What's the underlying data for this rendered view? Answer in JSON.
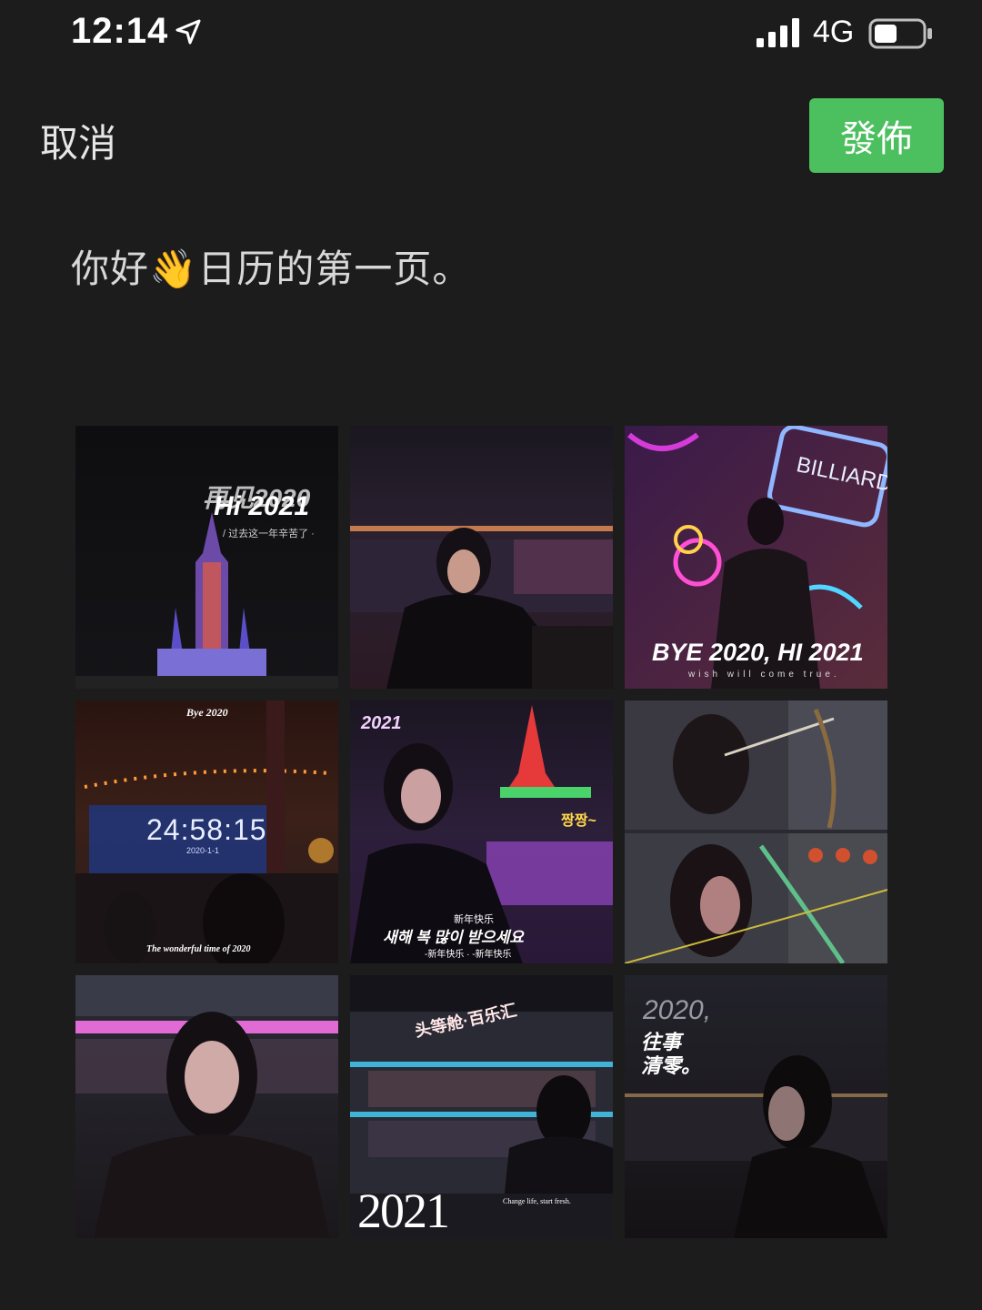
{
  "status_bar": {
    "time": "12:14",
    "network": "4G",
    "icons": [
      "location-arrow-icon",
      "signal-bars-icon",
      "battery-icon"
    ]
  },
  "header": {
    "cancel_label": "取消",
    "publish_label": "發佈",
    "publish_color": "#4cbf5f"
  },
  "post": {
    "text_before": "你好",
    "emoji": "👋",
    "text_after": "日历的第一页。"
  },
  "photos": [
    {
      "name": "photo-hi-2021-castle",
      "overlay_top": "再见2020",
      "overlay_main": "Hi 2021",
      "overlay_sub": "/ 过去这一年辛苦了 ·"
    },
    {
      "name": "photo-riverside-night"
    },
    {
      "name": "photo-billiard-neon",
      "sign": "BILLIARD",
      "overlay_main": "BYE 2020, HI 2021",
      "overlay_sub": "wish will come true."
    },
    {
      "name": "photo-countdown-clock",
      "overlay_top": "Bye 2020",
      "clock": "24:58:15",
      "clock_date": "2020-1-1",
      "overlay_sub": "The wonderful time of 2020"
    },
    {
      "name": "photo-new-year-korean",
      "overlay_top": "2021",
      "sticker": "짱짱~",
      "overlay_small": "新年快乐",
      "overlay_main": "새해 복 많이 받으세요",
      "overlay_sub": "-新年快乐 · -新年快乐"
    },
    {
      "name": "photo-archery"
    },
    {
      "name": "photo-fur-coat-portrait"
    },
    {
      "name": "photo-restaurant-boat-2021",
      "sign": "头等舱·百乐汇",
      "overlay_main": "2021",
      "overlay_sub": "Change life, start fresh."
    },
    {
      "name": "photo-2020-reset",
      "overlay_top": "2020,",
      "overlay_main": "往事",
      "overlay_sub": "清零。"
    }
  ]
}
